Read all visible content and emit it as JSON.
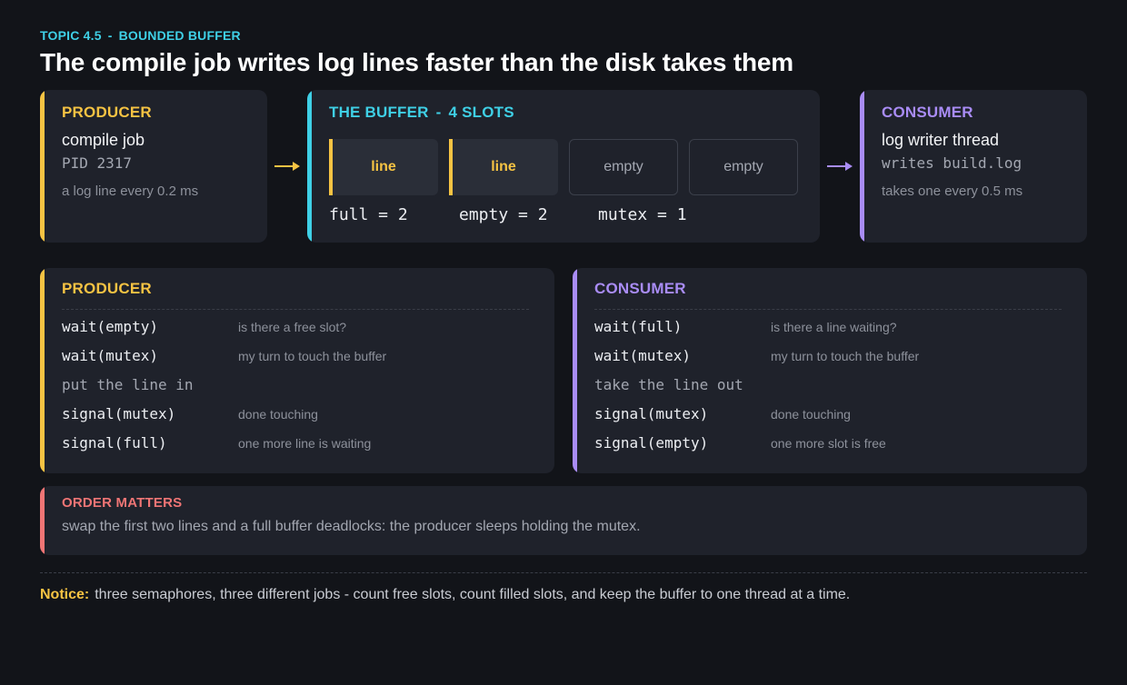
{
  "header": {
    "topic": "TOPIC 4.5",
    "separator": "-",
    "topic_name": "BOUNDED BUFFER",
    "title": "The compile job writes log lines faster than the disk takes them"
  },
  "producer_card": {
    "heading": "PRODUCER",
    "name": "compile job",
    "detail": "PID 2317",
    "rate": "a log line every 0.2 ms"
  },
  "buffer_card": {
    "heading": "THE BUFFER",
    "separator": "-",
    "slots_label": "4 SLOTS",
    "slots": [
      {
        "label": "line",
        "state": "full"
      },
      {
        "label": "line",
        "state": "full"
      },
      {
        "label": "empty",
        "state": "empty"
      },
      {
        "label": "empty",
        "state": "empty"
      }
    ],
    "semaphores": [
      "full = 2",
      "empty = 2",
      "mutex = 1"
    ]
  },
  "consumer_card": {
    "heading": "CONSUMER",
    "name": "log writer thread",
    "detail": "writes build.log",
    "rate": "takes one every 0.5 ms"
  },
  "producer_steps": {
    "heading": "PRODUCER",
    "steps": [
      {
        "code": "wait(empty)",
        "note": "is there a free slot?"
      },
      {
        "code": "wait(mutex)",
        "note": "my turn to touch the buffer"
      },
      {
        "code": "put the line in",
        "note": ""
      },
      {
        "code": "signal(mutex)",
        "note": "done touching"
      },
      {
        "code": "signal(full)",
        "note": "one more line is waiting"
      }
    ]
  },
  "consumer_steps": {
    "heading": "CONSUMER",
    "steps": [
      {
        "code": "wait(full)",
        "note": "is there a line waiting?"
      },
      {
        "code": "wait(mutex)",
        "note": "my turn to touch the buffer"
      },
      {
        "code": "take the line out",
        "note": ""
      },
      {
        "code": "signal(mutex)",
        "note": "done touching"
      },
      {
        "code": "signal(empty)",
        "note": "one more slot is free"
      }
    ]
  },
  "order_card": {
    "heading": "ORDER MATTERS",
    "text": "swap the first two lines and a full buffer deadlocks: the producer sleeps holding the mutex."
  },
  "footer": {
    "label": "Notice:",
    "text": "three semaphores, three different jobs - count free slots, count filled slots, and keep the buffer to one thread at a time."
  },
  "colors": {
    "producer": "#f6c343",
    "buffer": "#3fd0e6",
    "consumer": "#a98cf5",
    "warning": "#f07575",
    "background": "#121419",
    "card": "#1f222b"
  }
}
